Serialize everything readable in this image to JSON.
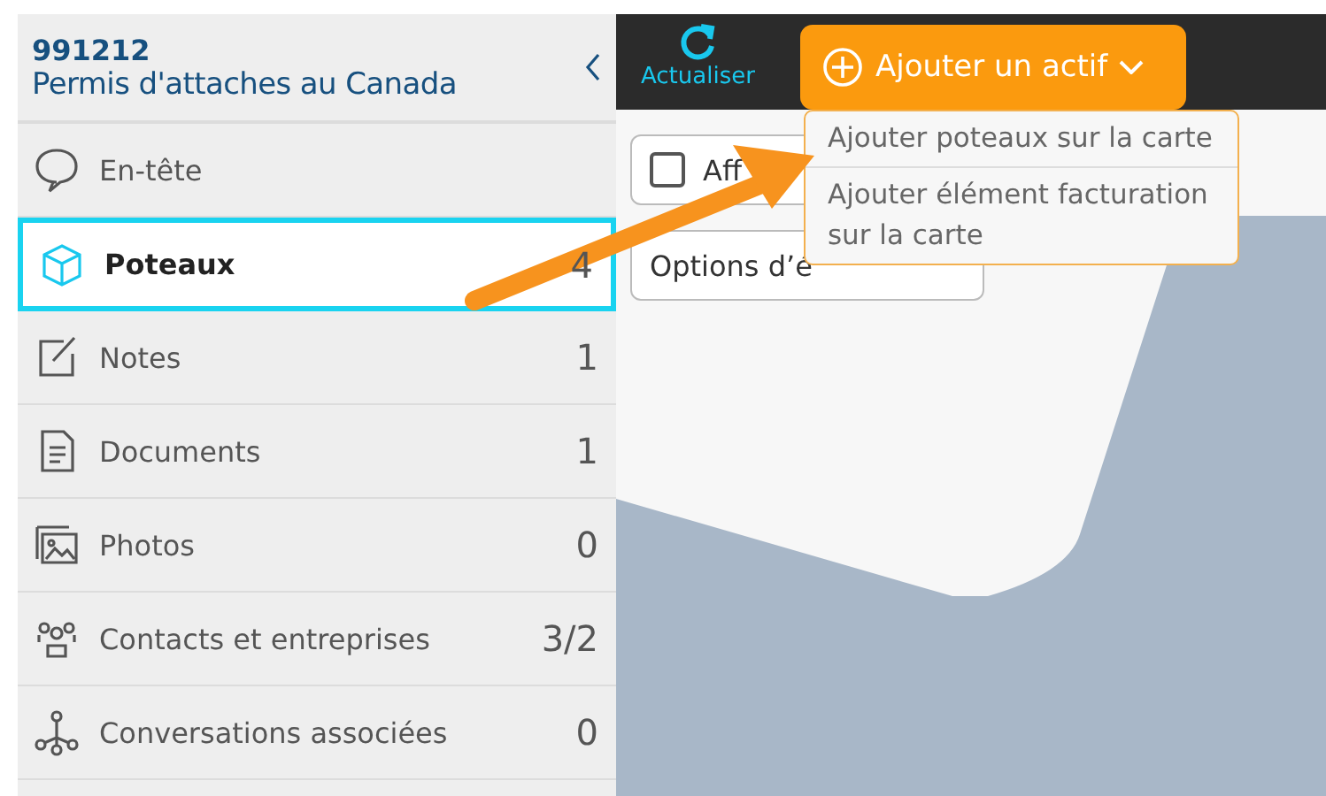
{
  "sidebar": {
    "record_id": "991212",
    "record_title": "Permis d'attaches au Canada",
    "items": [
      {
        "kind": "header",
        "label": "En-tête",
        "selected": false
      },
      {
        "kind": "poles",
        "label": "Poteaux",
        "count": "4",
        "selected": true
      },
      {
        "kind": "notes",
        "label": "Notes",
        "count": "1",
        "selected": false
      },
      {
        "kind": "documents",
        "label": "Documents",
        "count": "1",
        "selected": false
      },
      {
        "kind": "photos",
        "label": "Photos",
        "count": "0",
        "selected": false
      },
      {
        "kind": "contacts",
        "label": "Contacts et entreprises",
        "count": "3/2",
        "selected": false
      },
      {
        "kind": "conversations",
        "label": "Conversations associées",
        "count": "0",
        "selected": false
      }
    ]
  },
  "toolbar": {
    "refresh_label": "Actualiser",
    "add_button": "Ajouter un actif",
    "add_menu": {
      "expanded": true,
      "items": [
        "Ajouter poteaux sur la carte",
        "Ajouter élément facturation sur la carte"
      ]
    }
  },
  "map_panel": {
    "display_checkbox": {
      "label": "Aff",
      "checked": false
    },
    "options_field": "Options d’é"
  }
}
